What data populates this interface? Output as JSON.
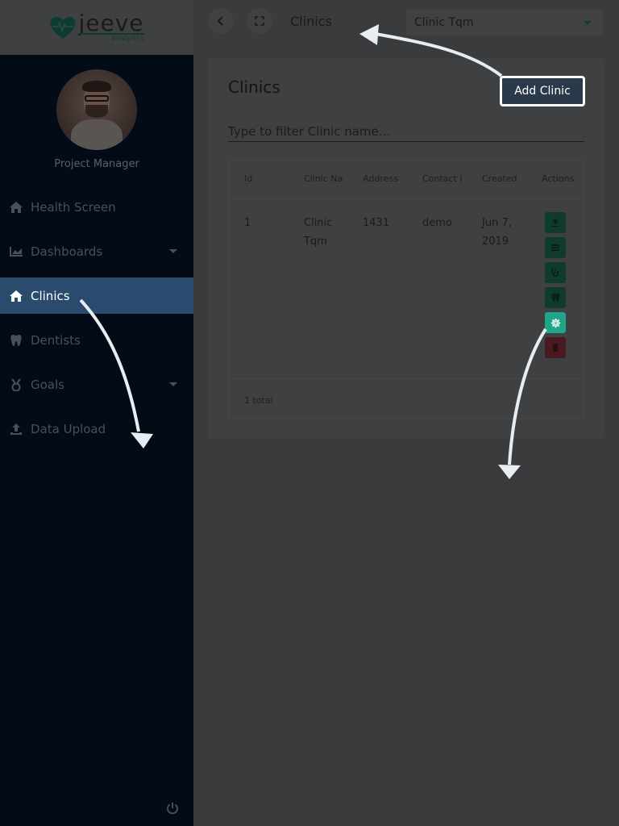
{
  "app": {
    "logo_main": "jeeve",
    "logo_sub": "analytics"
  },
  "sidebar": {
    "role": "Project Manager",
    "items": [
      {
        "label": "Health Screen",
        "icon": "home-icon"
      },
      {
        "label": "Dashboards",
        "icon": "chart-icon",
        "has_caret": true
      },
      {
        "label": "Clinics",
        "icon": "home-icon",
        "active": true
      },
      {
        "label": "Dentists",
        "icon": "tooth-icon"
      },
      {
        "label": "Goals",
        "icon": "medal-icon",
        "has_caret": true
      },
      {
        "label": "Data Upload",
        "icon": "upload-icon"
      }
    ],
    "power_icon": "power-icon"
  },
  "topbar": {
    "title": "Clinics",
    "clinic_selected": "Clinic Tqm"
  },
  "card": {
    "title": "Clinics",
    "add_button": "Add Clinic",
    "filter_placeholder": "Type to filter Clinic name...",
    "columns": [
      "Id",
      "Clinic Na",
      "Address",
      "Contact I",
      "Created",
      "Actions"
    ],
    "rows": [
      {
        "id": "1",
        "clinic_name": "Clinic Tqm",
        "address": "1431",
        "contact": "demo",
        "created": "Jun 7, 2019"
      }
    ],
    "total": "1 total"
  },
  "colors": {
    "accent": "#1fa68a",
    "active_nav": "#2a4a6e",
    "sidebar_bg": "#030b16"
  }
}
